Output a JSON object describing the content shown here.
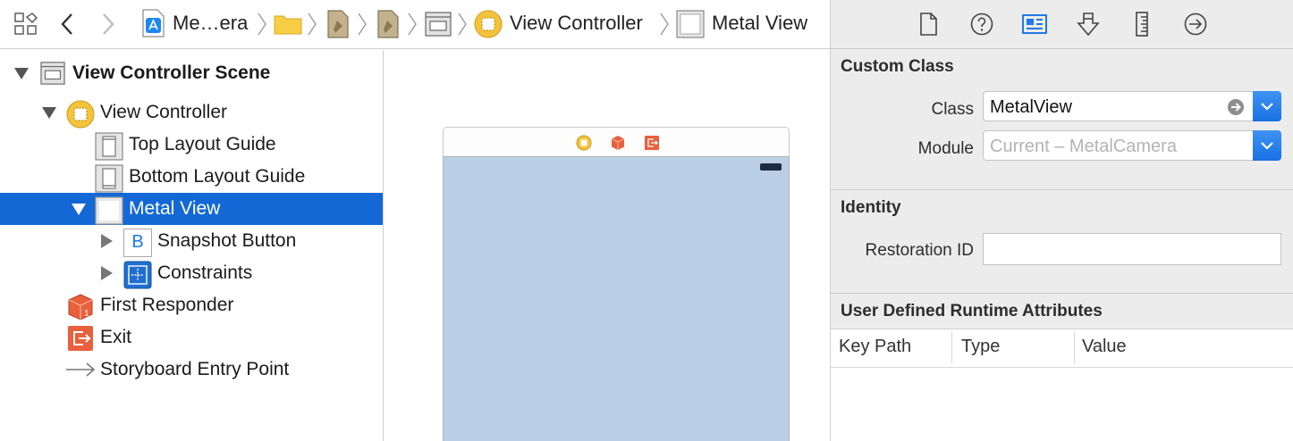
{
  "jumpbar": {
    "crumbs": [
      "Me…era",
      "View Controller",
      "Metal View"
    ]
  },
  "outline": {
    "items": [
      {
        "label": "View Controller Scene"
      },
      {
        "label": "View Controller"
      },
      {
        "label": "Top Layout Guide"
      },
      {
        "label": "Bottom Layout Guide"
      },
      {
        "label": "Metal View"
      },
      {
        "label": "Snapshot Button"
      },
      {
        "label": "Constraints"
      },
      {
        "label": "First Responder"
      },
      {
        "label": "Exit"
      },
      {
        "label": "Storyboard Entry Point"
      }
    ],
    "button_glyph": "B"
  },
  "inspector": {
    "custom_class": {
      "title": "Custom Class",
      "class_label": "Class",
      "class_value": "MetalView",
      "module_label": "Module",
      "module_placeholder": "Current – MetalCamera"
    },
    "identity": {
      "title": "Identity",
      "restoration_label": "Restoration ID",
      "restoration_value": ""
    },
    "runtime": {
      "title": "User Defined Runtime Attributes",
      "columns": [
        "Key Path",
        "Type",
        "Value"
      ]
    }
  },
  "colors": {
    "selection": "#1368d6",
    "accent_blue": "#1e7ae6",
    "view_background": "#bacfe6",
    "first_responder": "#e8603c",
    "view_controller": "#f5c33b"
  }
}
